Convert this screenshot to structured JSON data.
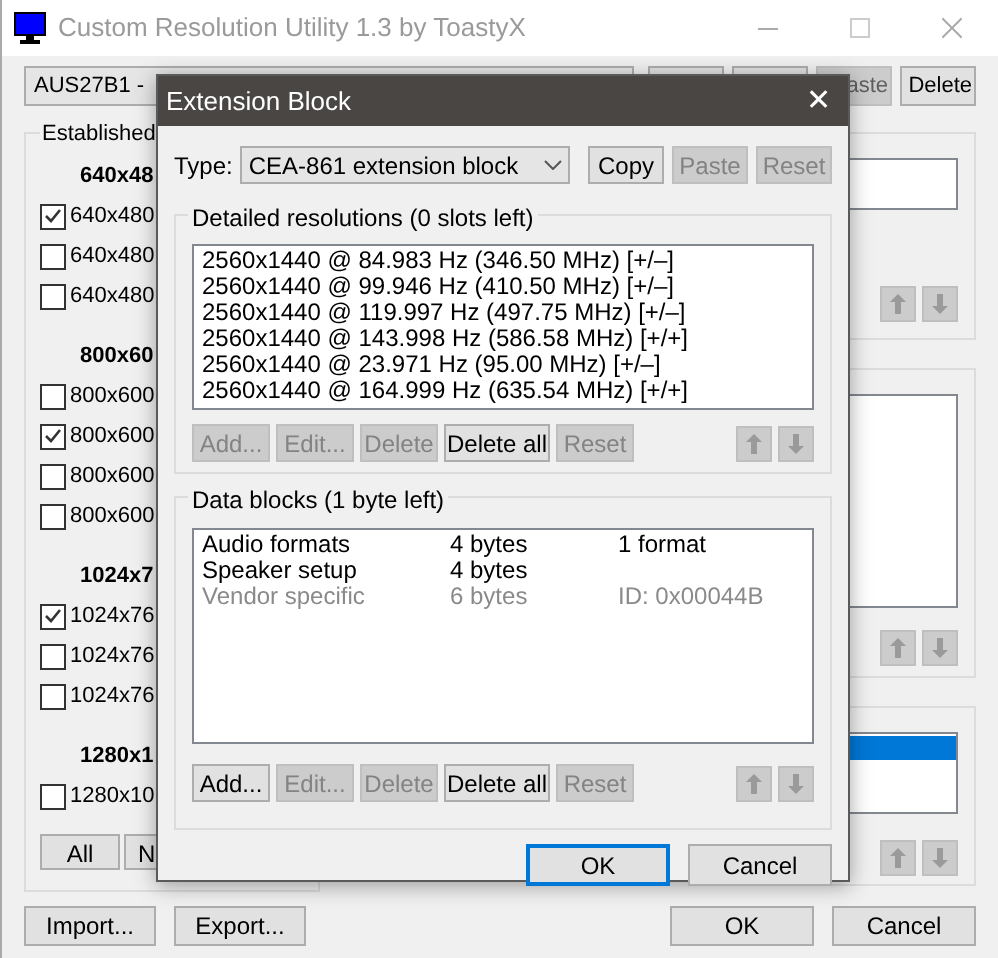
{
  "window": {
    "title": "Custom Resolution Utility 1.3 by ToastyX"
  },
  "device_select": {
    "value": "AUS27B1 -"
  },
  "top_buttons": [
    {
      "label": "aste",
      "disabled": true
    },
    {
      "label": "Delete",
      "disabled": false
    }
  ],
  "established": {
    "label": "Established",
    "sections": [
      {
        "heading": "640x48",
        "items": [
          {
            "label": "640x480",
            "checked": true
          },
          {
            "label": "640x480",
            "checked": false
          },
          {
            "label": "640x480",
            "checked": false
          }
        ]
      },
      {
        "heading": "800x60",
        "items": [
          {
            "label": "800x600",
            "checked": false
          },
          {
            "label": "800x600",
            "checked": true
          },
          {
            "label": "800x600",
            "checked": false
          },
          {
            "label": "800x600",
            "checked": false
          }
        ]
      },
      {
        "heading": "1024x7",
        "items": [
          {
            "label": "1024x76",
            "checked": true
          },
          {
            "label": "1024x76",
            "checked": false
          },
          {
            "label": "1024x76",
            "checked": false
          }
        ]
      },
      {
        "heading": "1280x1",
        "items": [
          {
            "label": "1280x10",
            "checked": false
          }
        ]
      }
    ],
    "buttons": [
      "All",
      "N"
    ]
  },
  "right_panels": [
    {
      "highlighted": false
    },
    {
      "highlighted": false
    },
    {
      "highlighted": true
    }
  ],
  "bottom_buttons": [
    "Import...",
    "Export...",
    "OK",
    "Cancel"
  ],
  "dialog": {
    "title": "Extension Block",
    "close": "✕",
    "type": {
      "label": "Type:",
      "value": "CEA-861 extension block"
    },
    "type_buttons": [
      {
        "label": "Copy",
        "disabled": false
      },
      {
        "label": "Paste",
        "disabled": true
      },
      {
        "label": "Reset",
        "disabled": true
      }
    ],
    "detailed": {
      "title": "Detailed resolutions (0 slots left)",
      "rows": [
        "2560x1440 @ 84.983 Hz (346.50 MHz) [+/–]",
        "2560x1440 @ 99.946 Hz (410.50 MHz) [+/–]",
        "2560x1440 @ 119.997 Hz (497.75 MHz) [+/–]",
        "2560x1440 @ 143.998 Hz (586.58 MHz) [+/+]",
        "2560x1440 @ 23.971 Hz (95.00 MHz) [+/–]",
        "2560x1440 @ 164.999 Hz (635.54 MHz) [+/+]"
      ],
      "buttons": [
        {
          "label": "Add...",
          "disabled": true
        },
        {
          "label": "Edit...",
          "disabled": true
        },
        {
          "label": "Delete",
          "disabled": true
        },
        {
          "label": "Delete all",
          "disabled": false
        },
        {
          "label": "Reset",
          "disabled": true
        }
      ]
    },
    "data_blocks": {
      "title": "Data blocks (1 byte left)",
      "rows": [
        {
          "name": "Audio formats",
          "size": "4 bytes",
          "info": "1 format",
          "disabled": false
        },
        {
          "name": "Speaker setup",
          "size": "4 bytes",
          "disabled": false
        },
        {
          "name": "Vendor specific",
          "size": "6 bytes",
          "info": "ID: 0x00044B",
          "disabled": true
        }
      ],
      "buttons": [
        {
          "label": "Add...",
          "disabled": false
        },
        {
          "label": "Edit...",
          "disabled": true
        },
        {
          "label": "Delete",
          "disabled": true
        },
        {
          "label": "Delete all",
          "disabled": false
        },
        {
          "label": "Reset",
          "disabled": true
        }
      ]
    },
    "ok": {
      "label": "OK",
      "default": true
    },
    "cancel": {
      "label": "Cancel"
    }
  }
}
